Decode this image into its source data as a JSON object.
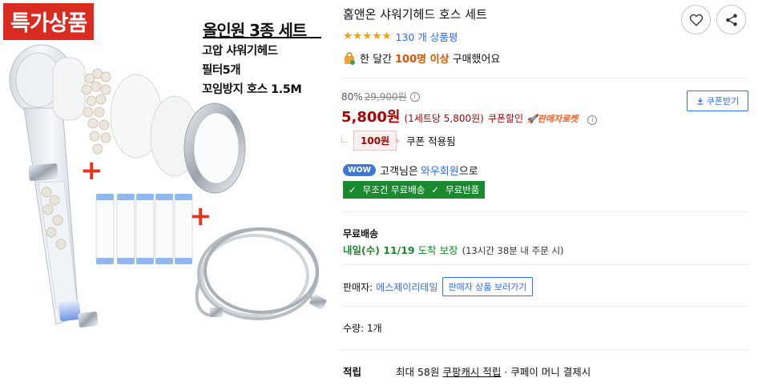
{
  "image": {
    "badge": "특가상품",
    "set_title": "올인원 3종 세트",
    "items": [
      "고압 샤워기헤드",
      "필터5개",
      "꼬임방지 호스 1.5M"
    ],
    "plus_symbol": "+"
  },
  "product": {
    "title": "홈앤온 샤워기헤드 호스 세트",
    "rating": 5,
    "review_count_text": "130 개 상품평",
    "bought": {
      "prefix": "한 달간",
      "highlight": "100명 이상",
      "suffix": "구매했어요"
    }
  },
  "icons": {
    "wishlist": "heart-icon",
    "share": "share-icon",
    "bag": "shopping-bag-icon",
    "download": "download-icon",
    "info": "info-icon",
    "check": "check-icon"
  },
  "price": {
    "discount_rate": "80%",
    "original": "29,900원",
    "sale": "5,800원",
    "per_set": "(1세트당 5,800원)",
    "coupon_label": "쿠폰할인",
    "rocket_label": "판매자로켓",
    "coupon_button": "쿠폰받기",
    "coupon_amount": "100원",
    "coupon_applied": "쿠폰 적용됨"
  },
  "wow": {
    "badge": "WOW",
    "prefix": "고객님은",
    "link": "와우회원",
    "suffix": "으로"
  },
  "free_shipping": {
    "items": [
      "무조건 무료배송",
      "무료반품"
    ]
  },
  "shipping": {
    "label": "무료배송",
    "date": "내일(수) 11/19",
    "guarantee": "도착 보장",
    "detail": "(13시간 38분 내 주문 시)"
  },
  "seller": {
    "label": "판매자:",
    "name": "에스제이리테일",
    "button": "판매자 상품 보러가기"
  },
  "quantity": {
    "label": "수량:",
    "value": "1개"
  },
  "points": {
    "label": "적립",
    "text": "최대 58원",
    "link": "쿠팡캐시 적립",
    "suffix": "· 쿠페이 머니 결제시"
  },
  "colors": {
    "price_red": "#ae0000",
    "link_blue": "#346aff",
    "green": "#1b8a2e",
    "star": "#f4a400",
    "orange": "#e65100",
    "badge_red": "#d92b1f"
  }
}
